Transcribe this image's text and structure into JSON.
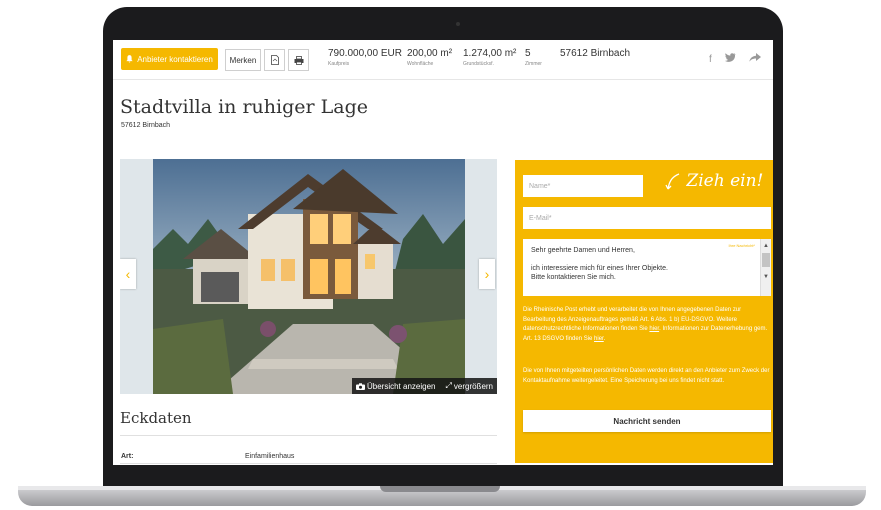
{
  "header": {
    "contact_label": "Anbieter kontaktieren",
    "merken_label": "Merken",
    "facts": [
      {
        "value": "790.000,00 EUR",
        "label": "Kaufpreis"
      },
      {
        "value": "200,00 m²",
        "label": "Wohnfläche"
      },
      {
        "value": "1.274,00 m²",
        "label": "Grundstücksf."
      },
      {
        "value": "5",
        "label": "Zimmer"
      }
    ],
    "location": "57612 Birnbach"
  },
  "listing": {
    "title": "Stadtvilla in ruhiger Lage",
    "subtitle": "57612 Birnbach"
  },
  "gallery": {
    "overview_label": "Übersicht anzeigen",
    "enlarge_label": "vergrößern"
  },
  "eckdaten": {
    "heading": "Eckdaten",
    "rows": [
      {
        "key": "Art:",
        "value": "Einfamilienhaus"
      }
    ]
  },
  "form": {
    "name_placeholder": "Name*",
    "email_placeholder": "E-Mail*",
    "slogan": "Zieh ein!",
    "message_hint": "Ihre Nachricht*",
    "message_lines": [
      "Sehr geehrte Damen und Herren,",
      "ich interessiere mich für eines Ihrer Objekte.",
      "Bitte kontaktieren Sie mich."
    ],
    "privacy_text": "Die Rheinische Post erhebt und verarbeitet die von Ihnen angegebenen Daten zur Bearbeitung des Anzeigenauftrages gemäß Art. 6 Abs. 1 b) EU-DSGVO. Weitere datenschutzrechtliche Informationen finden Sie",
    "privacy_link1": "hier",
    "privacy_text2": ". Informationen zur Datenerhebung gem. Art. 13 DSGVO finden Sie",
    "privacy_link2": "hier",
    "privacy_end": ".",
    "forward_text": "Die von Ihnen mitgeteilten persönlichen Daten werden direkt an den Anbieter zum Zweck der Kontaktaufnahme weitergeleitet. Eine Speicherung bei uns findet nicht statt.",
    "send_label": "Nachricht senden"
  },
  "colors": {
    "accent": "#f5b800"
  }
}
